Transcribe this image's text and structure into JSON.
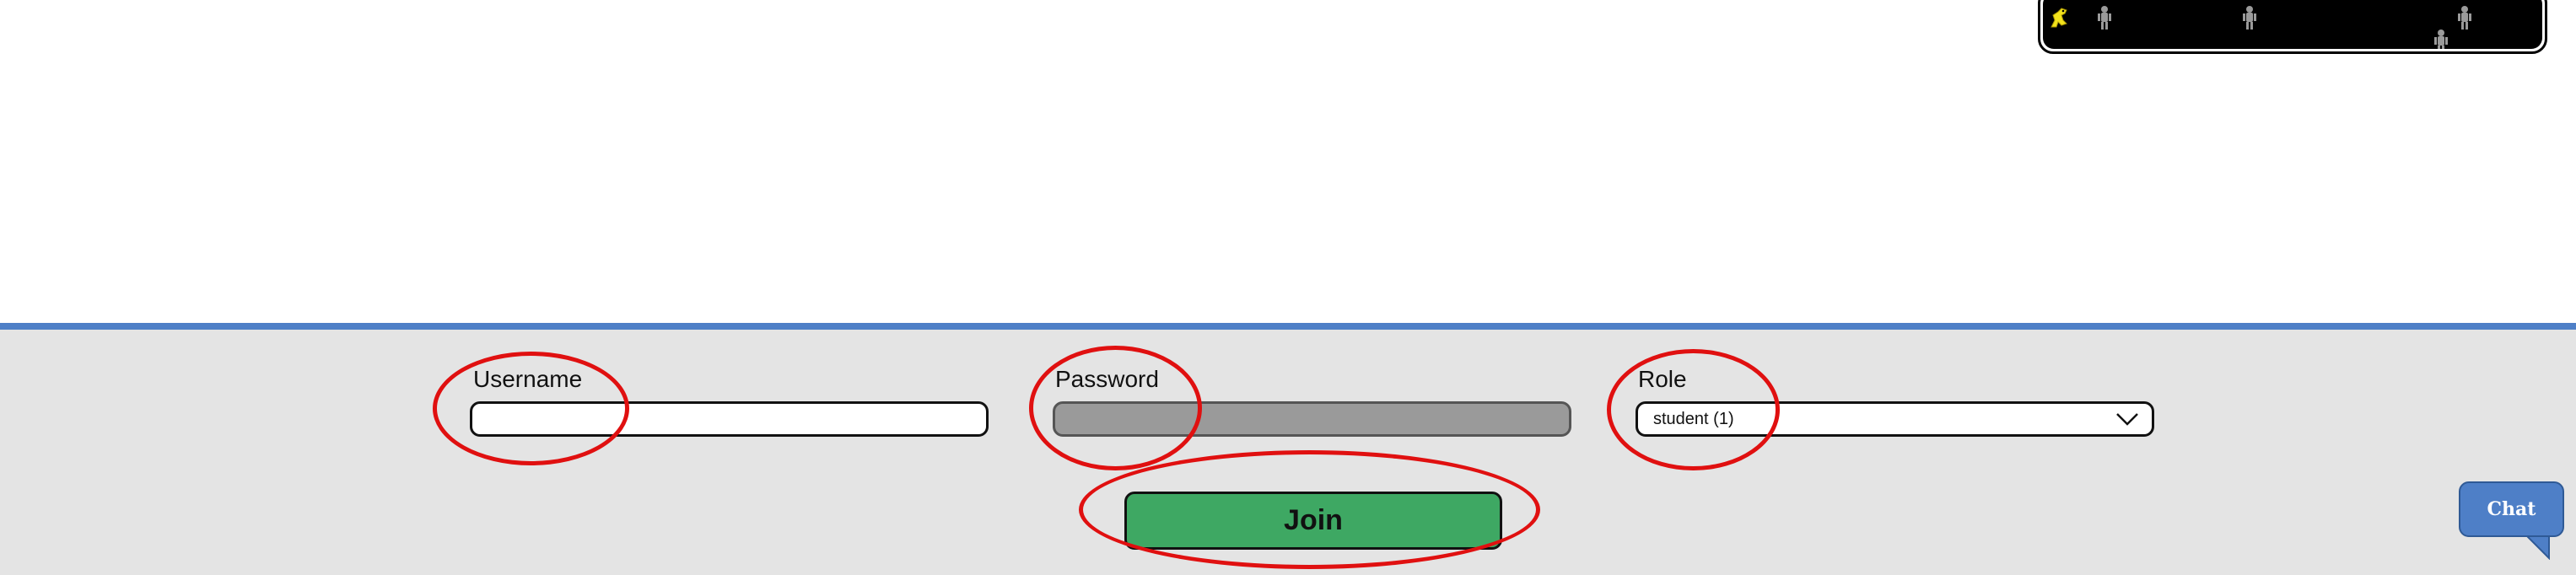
{
  "form": {
    "username_label": "Username",
    "username_value": "",
    "password_label": "Password",
    "password_value": "",
    "role_label": "Role",
    "role_selected": "student (1)",
    "join_label": "Join"
  },
  "chat": {
    "label": "Chat"
  },
  "colors": {
    "panel_background": "#e4e4e4",
    "panel_top_border": "#4e7fc7",
    "join_button": "#3ea863",
    "highlight_ring": "#e01010",
    "chat_button": "#4e7fc7"
  },
  "icons": {
    "role_dropdown": "chevron-down-icon",
    "game_player": "dinosaur-icon",
    "game_people": "person-figure-icon"
  }
}
